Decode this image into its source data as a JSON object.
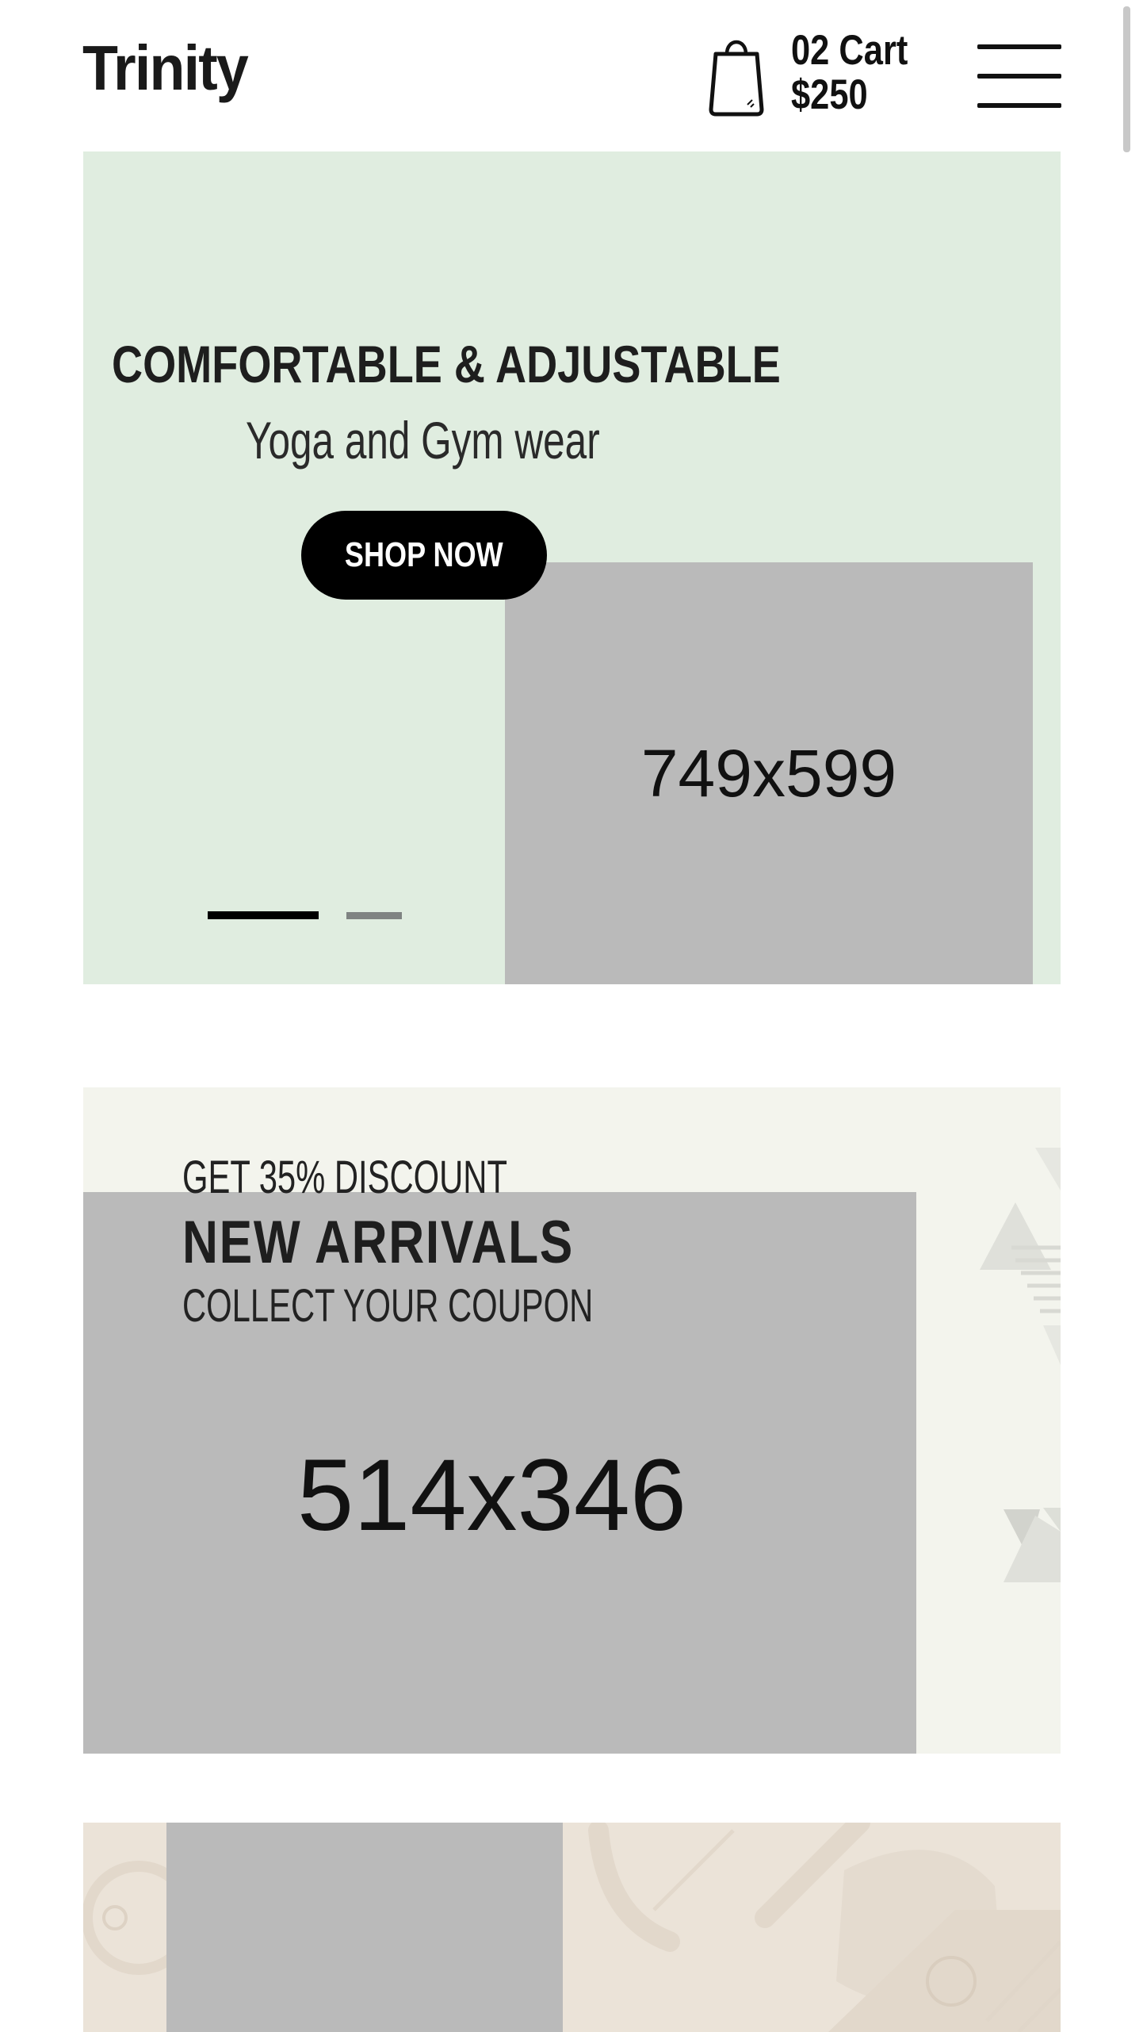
{
  "header": {
    "logo": "Trinity",
    "cart_count_label": "02 Cart",
    "cart_total": "$250",
    "cart_icon": "shopping-bag-icon",
    "menu_icon": "hamburger-menu-icon"
  },
  "hero": {
    "title": "COMFORTABLE & ADJUSTABLE",
    "subtitle": "Yoga and Gym wear",
    "cta_label": "SHOP NOW",
    "image_placeholder": "749x599",
    "slider": {
      "slide_count": 2,
      "active_index": 0
    }
  },
  "promo": {
    "line1": "GET 35% DISCOUNT",
    "line2": "NEW ARRIVALS",
    "line3": "COLLECT YOUR COUPON",
    "image_placeholder": "514x346"
  },
  "colors": {
    "hero_bg": "#e0ede0",
    "promo_bg": "#f3f4ed",
    "promo2_bg": "#ebe3d8",
    "placeholder": "#bababa",
    "button_bg": "#000000",
    "dot_active": "#000000",
    "dot_inactive": "#7f8382"
  }
}
